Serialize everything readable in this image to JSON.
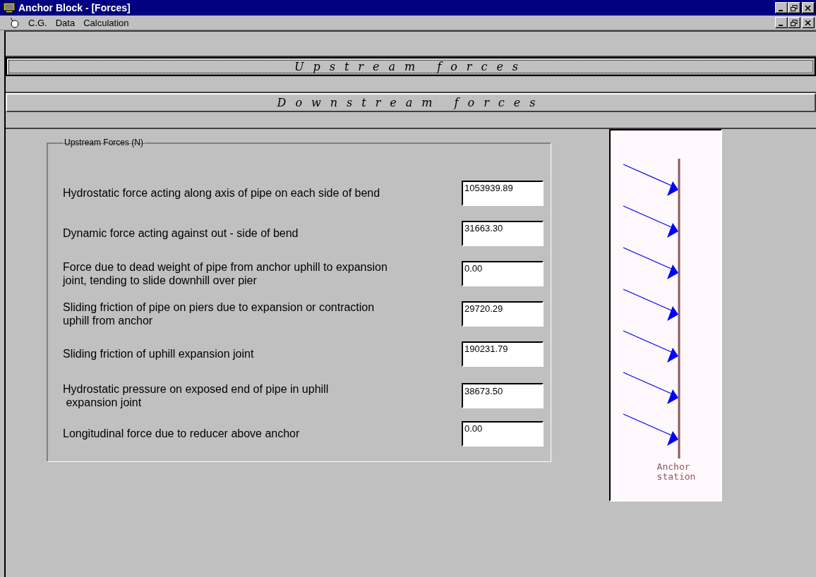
{
  "window": {
    "title": "Anchor Block - [Forces]"
  },
  "menu": [
    "C.G.",
    "Data",
    "Calculation"
  ],
  "section_buttons": [
    {
      "label": "Upstream forces",
      "selected": true
    },
    {
      "label": "Downstream forces",
      "selected": false
    }
  ],
  "group": {
    "title": "Upstream Forces (N)",
    "rows": [
      {
        "label": "Hydrostatic force acting along axis of pipe on each side of bend",
        "value": "1053939.89"
      },
      {
        "label": "Dynamic force acting against out - side of bend",
        "value": "31663.30"
      },
      {
        "label": "Force due to dead weight of pipe from anchor uphill to expansion joint, tending to slide downhill over pier",
        "value": "0.00"
      },
      {
        "label": "Sliding friction of pipe on piers due to expansion or contraction uphill from anchor",
        "value": "29720.29"
      },
      {
        "label": "Sliding friction of uphill expansion joint",
        "value": "190231.79"
      },
      {
        "label": "Hydrostatic pressure on exposed end of pipe in uphill\n expansion joint",
        "value": "38673.50"
      },
      {
        "label": "Longitudinal force due to reducer above anchor",
        "value": "0.00"
      }
    ]
  },
  "diagram": {
    "caption": "Anchor\nstation"
  }
}
